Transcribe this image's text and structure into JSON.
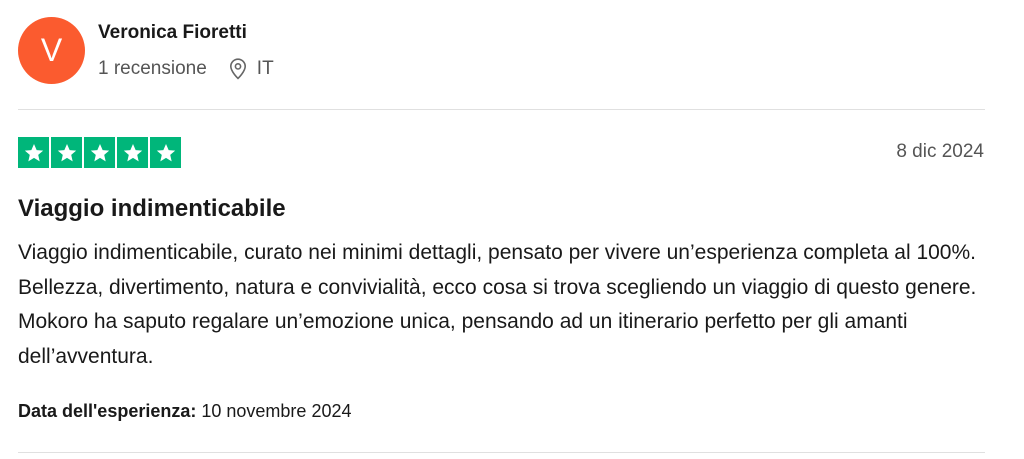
{
  "reviewer": {
    "initial": "V",
    "name": "Veronica Fioretti",
    "review_count": "1 recensione",
    "country": "IT",
    "avatar_color": "#fb5b2f"
  },
  "review": {
    "rating": 5,
    "max_rating": 5,
    "star_color": "#00b67a",
    "date": "8 dic 2024",
    "title": "Viaggio indimenticabile",
    "body": "Viaggio indimenticabile, curato nei minimi dettagli, pensato per vivere un’esperienza completa al 100%. Bellezza, divertimento, natura e convivialità, ecco cosa si trova scegliendo un viaggio di questo genere. Mokoro ha saputo regalare un’emozione unica, pensando ad un itinerario perfetto per gli amanti dell’avventura.",
    "experience_label": "Data dell'esperienza:",
    "experience_date": "10 novembre 2024"
  },
  "icons": {
    "location": "location-pin-icon",
    "star": "star-icon"
  }
}
